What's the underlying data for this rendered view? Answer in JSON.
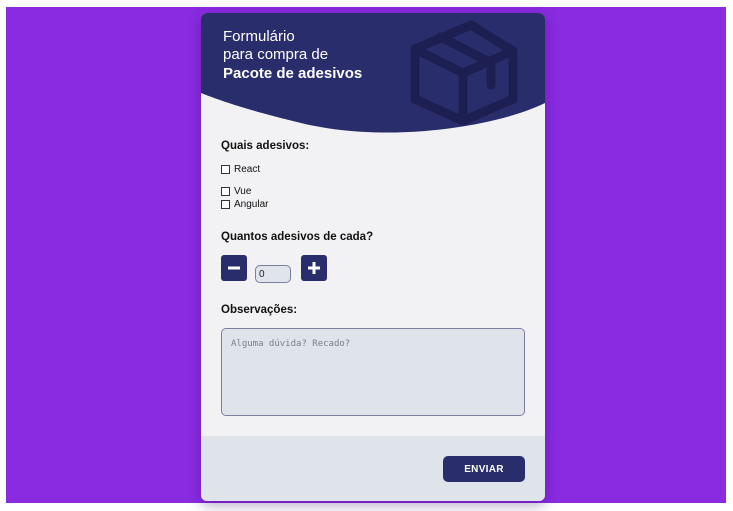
{
  "colors": {
    "page_background": "#8a2be2",
    "header": "#2a2d6b",
    "card": "#f2f2f4",
    "footer": "#dfe3ea",
    "button": "#2a2d6b"
  },
  "header": {
    "line1": "Formulário",
    "line2": "para compra de",
    "line3": "Pacote de adesivos",
    "icon": "package-box-icon"
  },
  "stickers": {
    "title": "Quais adesivos:",
    "options": [
      {
        "label": "React",
        "checked": false
      },
      {
        "label": "Vue",
        "checked": false
      },
      {
        "label": "Angular",
        "checked": false
      }
    ]
  },
  "quantity": {
    "title": "Quantos adesivos de cada?",
    "value": "0",
    "decrement_icon": "minus-icon",
    "increment_icon": "plus-icon"
  },
  "notes": {
    "title": "Observações:",
    "placeholder": "Alguma dúvida? Recado?"
  },
  "footer": {
    "submit_label": "ENVIAR"
  }
}
